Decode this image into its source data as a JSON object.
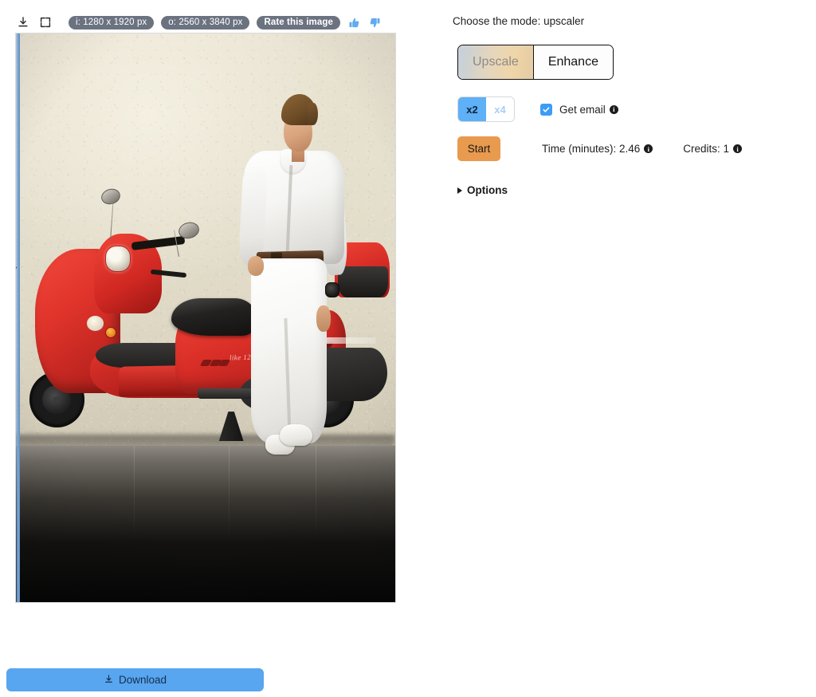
{
  "image_toolbar": {
    "download_icon": "download-icon",
    "fullscreen_icon": "fullscreen-icon",
    "input_size_badge": "i: 1280 x 1920 px",
    "output_size_badge": "o: 2560 x 3840 px",
    "rate_button": "Rate this image",
    "thumbs_up_icon": "thumbs-up-icon",
    "thumbs_down_icon": "thumbs-down-icon"
  },
  "preview": {
    "alt": "Young man in white shirt and white jeans leaning against a red scooter in front of a beige stucco wall",
    "comparison_slider_position": "0%",
    "scooter_script_text": "like 125"
  },
  "download": {
    "icon": "download-icon",
    "label": "Download"
  },
  "panel": {
    "mode_label": "Choose the mode: upscaler",
    "mode_segments": [
      {
        "label": "Upscale",
        "selected": true
      },
      {
        "label": "Enhance",
        "selected": false
      }
    ],
    "scale_options": [
      {
        "label": "x2",
        "selected": true
      },
      {
        "label": "x4",
        "selected": false
      }
    ],
    "get_email": {
      "label": "Get email",
      "checked": true,
      "check_icon": "check-icon",
      "info_icon": "info-icon",
      "info_glyph": "i"
    },
    "start_button": "Start",
    "time_label": "Time (minutes): 2.46",
    "time_info_icon": "info-icon",
    "credits_label": "Credits: 1",
    "credits_info_icon": "info-icon",
    "options_label": "Options",
    "options_expanded": false,
    "options_triangle_icon": "chevron-right-icon"
  },
  "colors": {
    "accent_blue": "#58a5f0",
    "scale_on": "#5eb0f7",
    "scale_off_text": "#a8cef5",
    "checkbox_blue": "#3d9cf5",
    "start_orange": "#e89a4e",
    "badge_gray": "#6b7280",
    "text": "#1a1a1a"
  }
}
